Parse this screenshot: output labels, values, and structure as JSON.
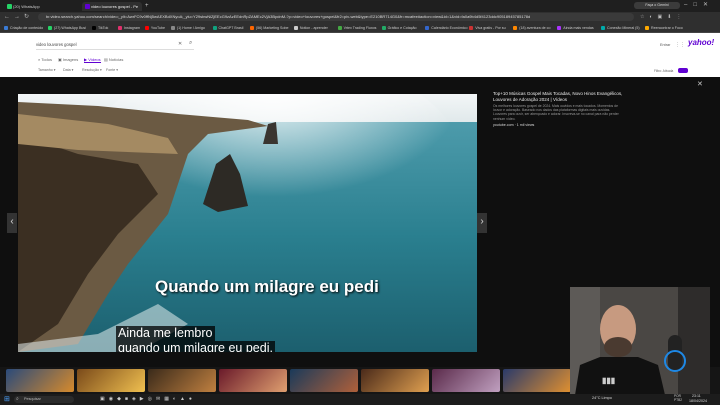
{
  "browser": {
    "tabs": [
      {
        "label": "(20) WhatsApp",
        "active": false
      },
      {
        "label": "video louvores gospel - Pe",
        "active": true
      }
    ],
    "new_tab_label": "+",
    "window_button": "Faça o Gemini",
    "url": "br.video.search.yahoo.com/search/video;_ylt=AwrFC9v0ffNj5wAEXBdXNyoA;_ylu=Y29sbwNiZjEEcG9zAzEEdnRpZAMEc2VjA3BpdnM-?p=video+louvores+gospel&fr2=piv-web&type=E210BR714G0&fr=mcafee#action=view&id=1&vid=fa0a9b4d5f4123ddc90518945785178d",
    "bookmarks": [
      "Criação de conteúdo",
      "(27) WhatsApp Busi",
      "TikTok",
      "Instagram",
      "YouTube",
      "(1) Home / Amigo",
      "ChatGPT Brasil",
      "(56) Marketing Sobe",
      "Notion - aprender",
      "Vrtex Trading Fluxos",
      "Gráfico e Cotação",
      "Calendário Econômico",
      "Viva gratis - Por su",
      "(18) aventura de co",
      "Ainda mais vendas",
      "Conexão Mineral (5)",
      "Reencontrar o Foco",
      "NOTAS"
    ]
  },
  "search": {
    "query": "video louvores gospel",
    "tabs": [
      "Todos",
      "Imagens",
      "Vídeos",
      "Notícias"
    ],
    "active_tab": "Vídeos",
    "filters": [
      "Tamanho ▾",
      "Data ▾",
      "Resolução ▾",
      "Fonte ▾"
    ],
    "header_links": [
      "Entrar"
    ],
    "safe_search": "Filtro: Ativada",
    "logo": "yahoo!"
  },
  "viewer": {
    "title": "Top+10 Músicas Gospel Mais Tocadas, Novo Hinos Evangélicos, Louvores de Adoração 2024 | Vídeos",
    "description": "Os melhores louvores gospel de 2024. Mais ouvidos e mais tocados. Momentos de louvor e adoração. Baseado nos dados das plataformas digitais mais ouvidas. Louvores para ouvir, ser abençoado e adorar. Inscreva-se no canal para não perder nenhum vídeo.",
    "source": "youtube.com",
    "views": "1 mil views",
    "close_label": "✕",
    "prev_label": "‹",
    "next_label": "›",
    "caption_big": "Quando um milagre eu pedi",
    "caption_small_line1": "Ainda me lembro",
    "caption_small_line2": "quando um milagre eu pedi."
  },
  "taskbar": {
    "search_label": "Pesquisar",
    "weather": "24°C Limpo",
    "language": "POR PTB2",
    "time": "23:11",
    "date": "18/04/2024"
  },
  "colors": {
    "yahoo_purple": "#6001d2",
    "sea": "#2b7c8c",
    "overlay": "#0f0f0f"
  }
}
